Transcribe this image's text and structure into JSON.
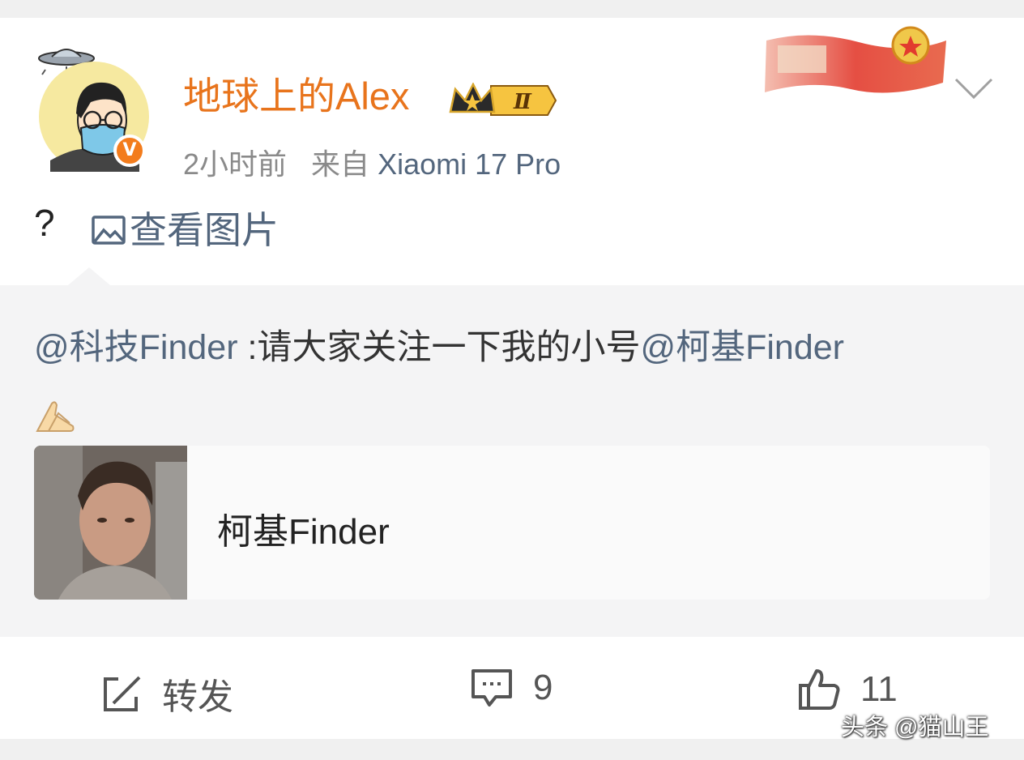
{
  "post": {
    "author": "地球上的Alex",
    "time": "2小时前",
    "source_prefix": "来自",
    "source_device": "Xiaomi 17 Pro",
    "verified_mark": "V",
    "badge_level": "Ⅱ",
    "text": "?",
    "view_picture": "查看图片"
  },
  "repost": {
    "mention_1": "@科技Finder",
    "body": " :请大家关注一下我的小号",
    "mention_2": "@柯基Finder",
    "emoji": "praying-hands-emoji",
    "card_name": "柯基Finder"
  },
  "actions": {
    "repost_label": "转发",
    "comment_count": "9",
    "like_count": "11"
  },
  "watermark": "头条 @猫山王",
  "colors": {
    "author": "#e8741c",
    "link": "#53667d",
    "meta": "#8a8a8a",
    "repost_bg": "#f4f4f5"
  }
}
